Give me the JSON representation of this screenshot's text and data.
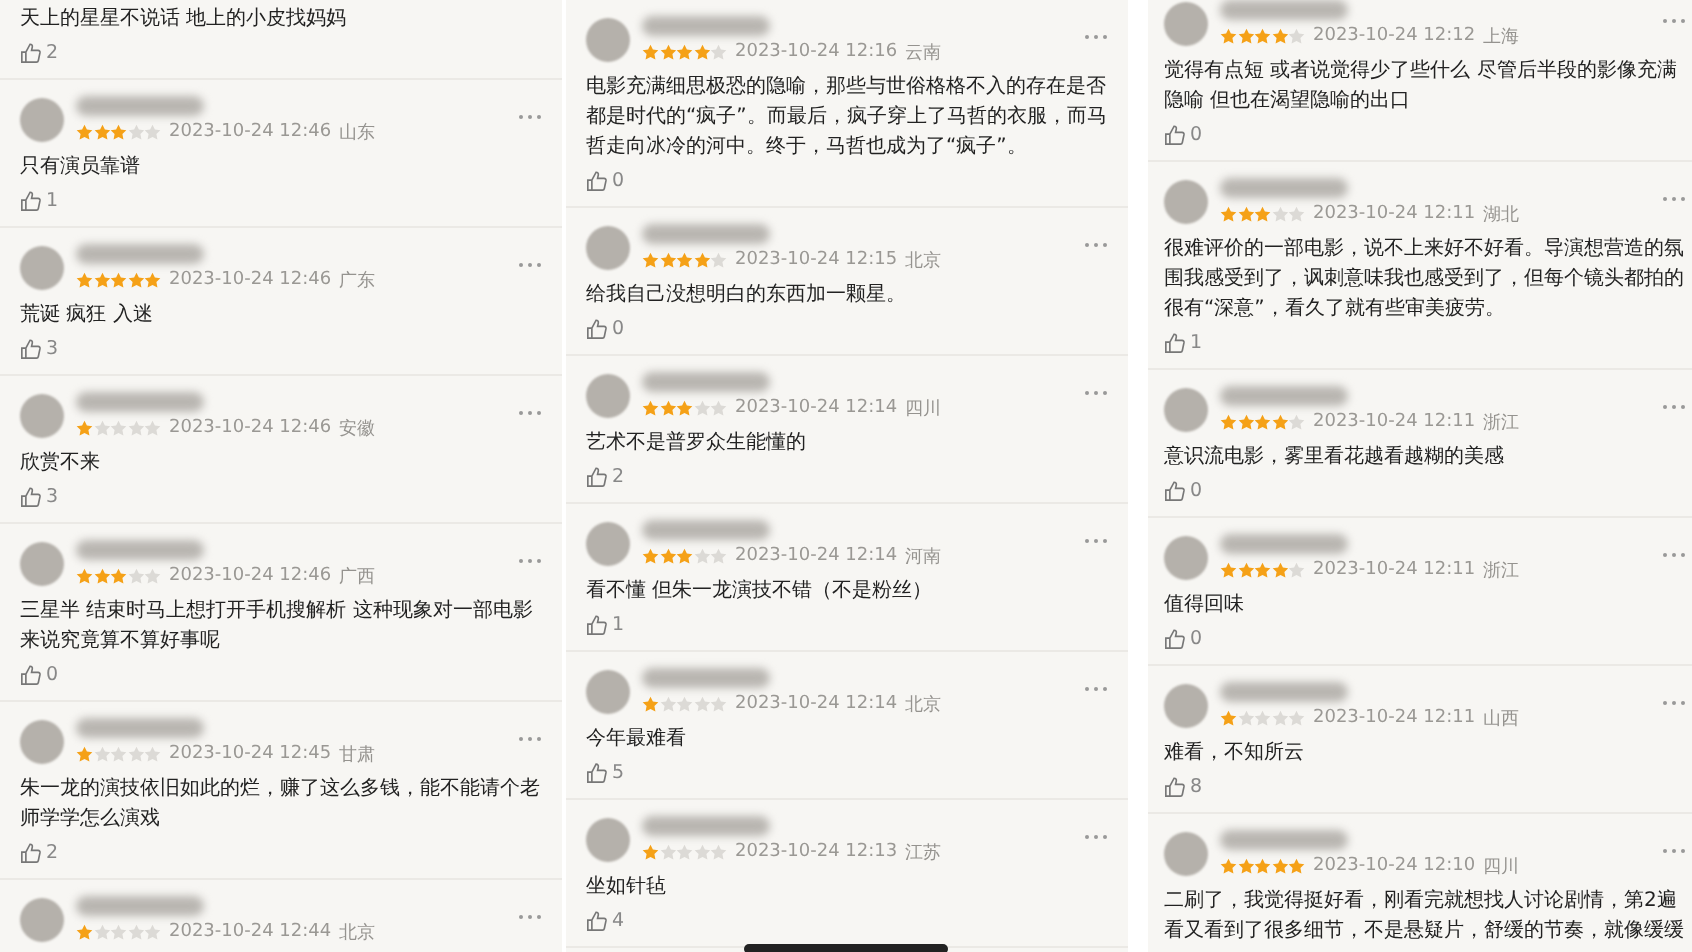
{
  "columns": [
    {
      "comments": [
        {
          "kind": "continuation",
          "text": "天上的星星不说话 地上的小皮找妈妈",
          "likes": "2"
        },
        {
          "kind": "full",
          "stars": 3,
          "time": "2023-10-24 12:46",
          "region": "山东",
          "text": "只有演员靠谱",
          "likes": "1"
        },
        {
          "kind": "full",
          "stars": 5,
          "time": "2023-10-24 12:46",
          "region": "广东",
          "text": "荒诞 疯狂 入迷",
          "likes": "3"
        },
        {
          "kind": "full",
          "stars": 1,
          "time": "2023-10-24 12:46",
          "region": "安徽",
          "text": "欣赏不来",
          "likes": "3"
        },
        {
          "kind": "full",
          "stars": 3,
          "time": "2023-10-24 12:46",
          "region": "广西",
          "text": "三星半 结束时马上想打开手机搜解析 这种现象对一部电影来说究竟算不算好事呢",
          "likes": "0"
        },
        {
          "kind": "full",
          "stars": 1,
          "time": "2023-10-24 12:45",
          "region": "甘肃",
          "text": "朱一龙的演技依旧如此的烂，赚了这么多钱，能不能请个老师学学怎么演戏",
          "likes": "2"
        },
        {
          "kind": "header",
          "stars": 1,
          "time": "2023-10-24 12:44",
          "region": "北京"
        }
      ]
    },
    {
      "comments": [
        {
          "kind": "full",
          "stars": 4,
          "time": "2023-10-24 12:16",
          "region": "云南",
          "text": "电影充满细思极恐的隐喻，那些与世俗格格不入的存在是否都是时代的“疯子”。而最后，疯子穿上了马哲的衣服，而马哲走向冰冷的河中。终于，马哲也成为了“疯子”。",
          "likes": "0"
        },
        {
          "kind": "full",
          "stars": 4,
          "time": "2023-10-24 12:15",
          "region": "北京",
          "text": "给我自己没想明白的东西加一颗星。",
          "likes": "0"
        },
        {
          "kind": "full",
          "stars": 3,
          "time": "2023-10-24 12:14",
          "region": "四川",
          "text": "艺术不是普罗众生能懂的",
          "likes": "2"
        },
        {
          "kind": "full",
          "stars": 3,
          "time": "2023-10-24 12:14",
          "region": "河南",
          "text": "看不懂 但朱一龙演技不错（不是粉丝）",
          "likes": "1"
        },
        {
          "kind": "full",
          "stars": 1,
          "time": "2023-10-24 12:14",
          "region": "北京",
          "text": "今年最难看",
          "likes": "5"
        },
        {
          "kind": "full",
          "stars": 1,
          "time": "2023-10-24 12:13",
          "region": "江苏",
          "text": "坐如针毡",
          "likes": "4"
        }
      ]
    },
    {
      "comments": [
        {
          "kind": "full",
          "stars": 4,
          "time": "2023-10-24 12:12",
          "region": "上海",
          "text": "觉得有点短 或者说觉得少了些什么 尽管后半段的影像充满隐喻 但也在渴望隐喻的出口",
          "likes": "0"
        },
        {
          "kind": "full",
          "stars": 3,
          "time": "2023-10-24 12:11",
          "region": "湖北",
          "text": "很难评价的一部电影，说不上来好不好看。导演想营造的氛围我感受到了，讽刺意味我也感受到了，但每个镜头都拍的很有“深意”，看久了就有些审美疲劳。",
          "likes": "1"
        },
        {
          "kind": "full",
          "stars": 4,
          "time": "2023-10-24 12:11",
          "region": "浙江",
          "text": "意识流电影，雾里看花越看越糊的美感",
          "likes": "0"
        },
        {
          "kind": "full",
          "stars": 4,
          "time": "2023-10-24 12:11",
          "region": "浙江",
          "text": "值得回味",
          "likes": "0"
        },
        {
          "kind": "full",
          "stars": 1,
          "time": "2023-10-24 12:11",
          "region": "山西",
          "text": "难看，不知所云",
          "likes": "8"
        },
        {
          "kind": "full",
          "stars": 5,
          "time": "2023-10-24 12:10",
          "region": "四川",
          "text": "二刷了，我觉得挺好看，刚看完就想找人讨论剧情，第2遍看又看到了很多细节，不是悬疑片，舒缓的节奏，就像缓缓"
        }
      ]
    }
  ]
}
